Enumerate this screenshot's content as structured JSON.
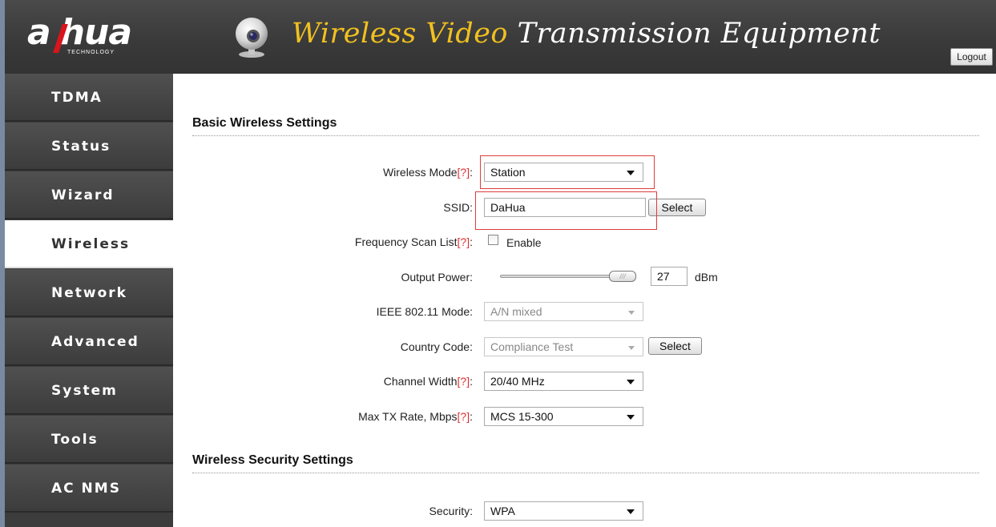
{
  "header": {
    "logo_word_left": "a",
    "logo_word_right": "hua",
    "logo_sub": "TECHNOLOGY",
    "title_accent": "Wireless Video",
    "title_rest": " Transmission Equipment",
    "logout_label": "Logout",
    "icon": "webcam-icon"
  },
  "sidebar": {
    "items": [
      {
        "label": "TDMA"
      },
      {
        "label": "Status"
      },
      {
        "label": "Wizard"
      },
      {
        "label": "Wireless"
      },
      {
        "label": "Network"
      },
      {
        "label": "Advanced"
      },
      {
        "label": "System"
      },
      {
        "label": "Tools"
      },
      {
        "label": "AC NMS"
      }
    ],
    "active": "Wireless"
  },
  "basic": {
    "heading": "Basic Wireless Settings",
    "help_marker": "[?]",
    "wireless_mode": {
      "label": "Wireless Mode",
      "value": "Station"
    },
    "ssid": {
      "label": "SSID:",
      "value": "DaHua",
      "button": "Select"
    },
    "scan_list": {
      "label": "Frequency Scan List",
      "checkbox_label": "Enable",
      "checked": false
    },
    "output_power": {
      "label": "Output Power:",
      "value": "27",
      "unit": "dBm",
      "slider_handle": "///"
    },
    "ieee_mode": {
      "label": "IEEE 802.11 Mode:",
      "value": "A/N mixed"
    },
    "country_code": {
      "label": "Country Code:",
      "value": "Compliance Test",
      "button": "Select"
    },
    "channel_width": {
      "label": "Channel Width",
      "value": "20/40 MHz"
    },
    "max_tx_rate": {
      "label": "Max TX Rate, Mbps",
      "value": "MCS 15-300"
    }
  },
  "security": {
    "heading": "Wireless Security Settings",
    "security": {
      "label": "Security:",
      "value": "WPA"
    }
  },
  "colors": {
    "accent": "#f0c020",
    "highlight": "#e03c3c",
    "help": "#e03030",
    "nav_bg": "#3c3c3c"
  }
}
